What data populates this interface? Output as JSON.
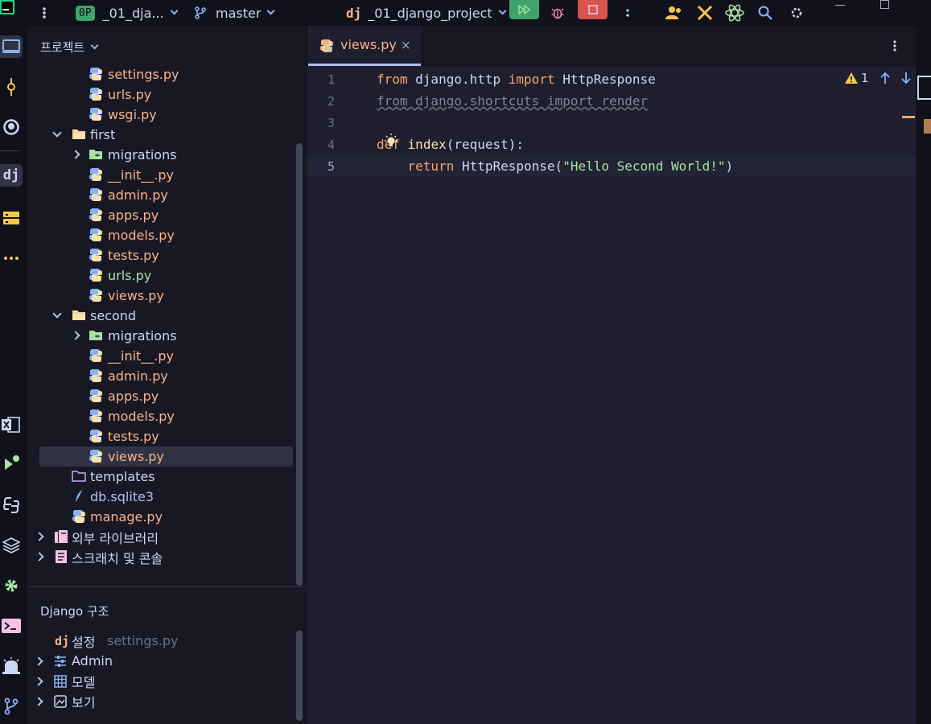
{
  "titlebar": {
    "project_badge": "0P",
    "project_name": "_01_dja...",
    "branch": "master",
    "run_config_icon": "dj",
    "run_config": "_01_django_project",
    "icons": [
      "menu-dots-icon",
      "git-branch-icon",
      "run-icon",
      "debug-icon",
      "stop-icon",
      "more-icon",
      "collab-icon",
      "tools-icon",
      "ai-icon",
      "search-icon",
      "settings-icon",
      "minimize-icon",
      "maximize-icon"
    ]
  },
  "toolstrip": {
    "top_icons": [
      "project-icon",
      "commit-icon",
      "github-icon",
      "django-icon",
      "database-icon",
      "more-icon"
    ],
    "bottom_icons": [
      "excel-icon",
      "run-icon",
      "python-console-icon",
      "layers-icon",
      "services-icon",
      "terminal-icon",
      "problems-icon",
      "git-icon"
    ]
  },
  "project_panel": {
    "title": "프로젝트",
    "tree": [
      {
        "label": "settings.py",
        "type": "py",
        "color": "orange"
      },
      {
        "label": "urls.py",
        "type": "py",
        "color": "orange"
      },
      {
        "label": "wsgi.py",
        "type": "py",
        "color": "orange"
      },
      {
        "label": "first",
        "type": "folder",
        "expanded": true
      },
      {
        "label": "migrations",
        "type": "migrations",
        "expanded": false
      },
      {
        "label": "__init__.py",
        "type": "py",
        "color": "orange"
      },
      {
        "label": "admin.py",
        "type": "py",
        "color": "orange"
      },
      {
        "label": "apps.py",
        "type": "py",
        "color": "orange"
      },
      {
        "label": "models.py",
        "type": "py",
        "color": "orange"
      },
      {
        "label": "tests.py",
        "type": "py",
        "color": "orange"
      },
      {
        "label": "urls.py",
        "type": "py",
        "color": "green"
      },
      {
        "label": "views.py",
        "type": "py",
        "color": "orange"
      },
      {
        "label": "second",
        "type": "folder",
        "expanded": true
      },
      {
        "label": "migrations",
        "type": "migrations",
        "expanded": false
      },
      {
        "label": "__init__.py",
        "type": "py",
        "color": "orange"
      },
      {
        "label": "admin.py",
        "type": "py",
        "color": "orange"
      },
      {
        "label": "apps.py",
        "type": "py",
        "color": "orange"
      },
      {
        "label": "models.py",
        "type": "py",
        "color": "orange"
      },
      {
        "label": "tests.py",
        "type": "py",
        "color": "orange"
      },
      {
        "label": "views.py",
        "type": "py",
        "color": "orange",
        "selected": true
      },
      {
        "label": "templates",
        "type": "folder-outline"
      },
      {
        "label": "db.sqlite3",
        "type": "sqlite",
        "color": "purple"
      },
      {
        "label": "manage.py",
        "type": "py",
        "color": "orange"
      },
      {
        "label": "외부 라이브러리",
        "type": "library",
        "expanded": false
      },
      {
        "label": "스크래치 및 콘솔",
        "type": "scratch",
        "expanded": false
      }
    ]
  },
  "django_panel": {
    "title": "Django 구조",
    "settings_icon": "dj",
    "settings_label": "설정",
    "settings_file": "settings.py",
    "items": [
      {
        "label": "Admin",
        "icon": "admin-icon"
      },
      {
        "label": "모델",
        "icon": "table-icon"
      },
      {
        "label": "보기",
        "icon": "view-icon"
      }
    ]
  },
  "editor": {
    "tab_label": "views.py",
    "tab_close": "×",
    "inspection_count": "1",
    "lines": [
      {
        "num": "1",
        "text": "from django.http import HttpResponse"
      },
      {
        "num": "2",
        "text": "from django.shortcuts import render"
      },
      {
        "num": "3",
        "text": ""
      },
      {
        "num": "4",
        "text": "def index(request):"
      },
      {
        "num": "5",
        "text": "    return HttpResponse(\"Hello Second World!\")"
      }
    ]
  },
  "colors": {
    "accent": "#b4befe",
    "py_file": "#fab387",
    "modified_file": "#a6e3a1",
    "keyword": "#f9a86b",
    "string": "#a6e3a1",
    "run_green": "#40a36b",
    "stop_red": "#d9534f"
  }
}
